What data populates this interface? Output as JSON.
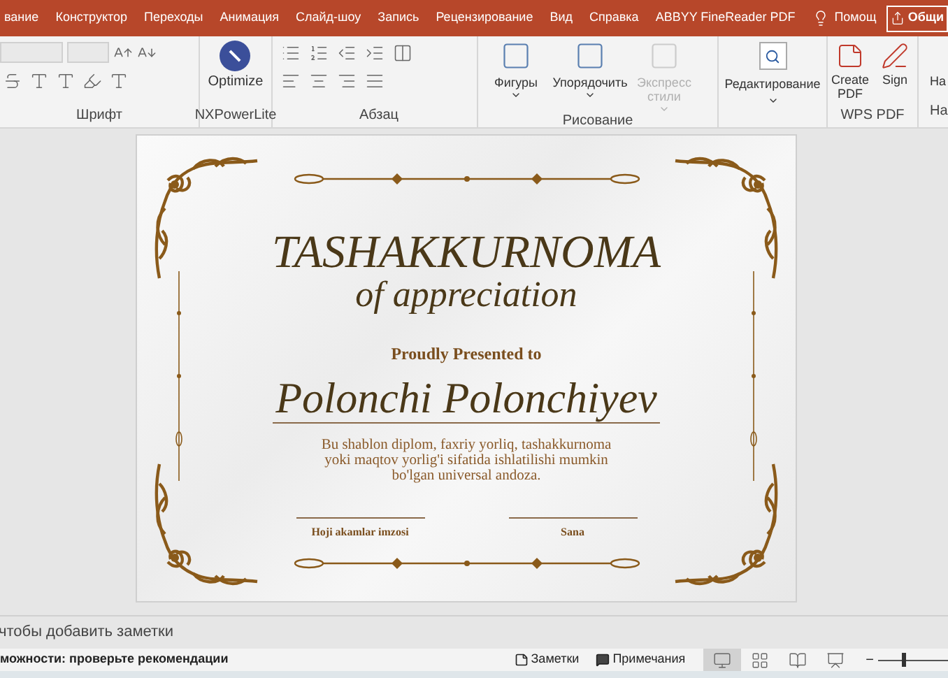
{
  "tabs": [
    {
      "label": "вание"
    },
    {
      "label": "Конструктор"
    },
    {
      "label": "Переходы"
    },
    {
      "label": "Анимация"
    },
    {
      "label": "Слайд-шоу"
    },
    {
      "label": "Запись"
    },
    {
      "label": "Рецензирование"
    },
    {
      "label": "Вид"
    },
    {
      "label": "Справка"
    },
    {
      "label": "ABBYY FineReader PDF"
    }
  ],
  "help": {
    "label": "Помощ"
  },
  "share": {
    "label": "Общи"
  },
  "ribbon": {
    "font_group": {
      "label": "Шрифт"
    },
    "nxpowerlite_group": {
      "label": "NXPowerLite",
      "button": "Optimize"
    },
    "paragraph_group": {
      "label": "Абзац"
    },
    "drawing_group": {
      "label": "Рисование",
      "buttons": [
        {
          "label": "Фигуры",
          "disabled": false
        },
        {
          "label": "Упорядочить",
          "disabled": false
        },
        {
          "label": "Экспресс стили",
          "disabled": true
        }
      ]
    },
    "editing_group": {
      "button": "Редактирование"
    },
    "wps_group": {
      "label": "WPS PDF",
      "buttons": [
        {
          "kind": "pdf",
          "label": "Create PDF"
        },
        {
          "kind": "sign",
          "label": "Sign"
        }
      ]
    },
    "cut_group": {
      "button": "На",
      "label": "На"
    }
  },
  "slide": {
    "title": "TASHAKKURNOMA",
    "subtitle": "of appreciation",
    "presented": "Proudly Presented to",
    "name": "Polonchi Polonchiyev",
    "body": "Bu shablon diplom, faxriy yorliq, tashakkurnoma yoki maqtov yorlig'i sifatida ishlatilishi mumkin bo'lgan universal andoza.",
    "signatures": [
      "Hoji akamlar imzosi",
      "Sana"
    ]
  },
  "notes": {
    "placeholder": "чтобы добавить заметки"
  },
  "status_bar": {
    "accessibility": "можности: проверьте рекомендации",
    "notes_button": "Заметки",
    "comments_button": "Примечания",
    "views": [
      {
        "kind": "normal",
        "selected": true
      },
      {
        "kind": "sorter",
        "selected": false
      },
      {
        "kind": "reading",
        "selected": false
      },
      {
        "kind": "slideshow",
        "selected": false
      }
    ],
    "zoom": {
      "out_symbol": "−",
      "level": 0.3
    }
  }
}
